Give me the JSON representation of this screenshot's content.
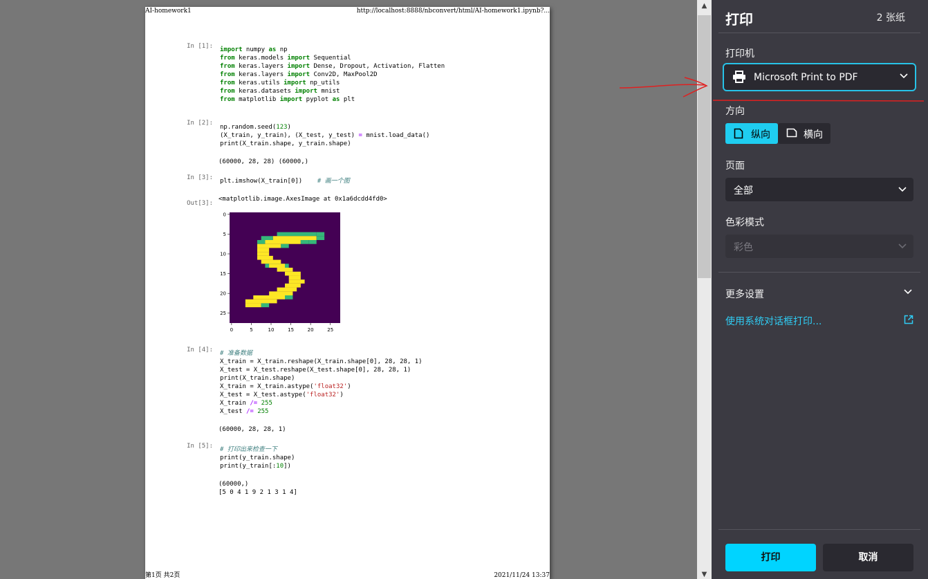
{
  "paper": {
    "header_left": "AI-homework1",
    "header_right": "http://localhost:8888/nbconvert/html/AI-homework1.ipynb?...",
    "footer_left": "第1页 共2页",
    "footer_right": "2021/11/24 13:37"
  },
  "notebook": {
    "prompts": [
      "In [1]:",
      "In [2]:",
      "In [3]:",
      "Out[3]:",
      "In [4]:",
      "In [5]:"
    ],
    "cell1": [
      {
        "kw": "import",
        "rest": " numpy ",
        "kw2": "as",
        "rest2": " np"
      },
      {
        "kw": "from",
        "rest": " keras.models ",
        "kw2": "import",
        "rest2": " Sequential"
      },
      {
        "kw": "from",
        "rest": " keras.layers ",
        "kw2": "import",
        "rest2": " Dense, Dropout, Activation, Flatten"
      },
      {
        "kw": "from",
        "rest": " keras.layers ",
        "kw2": "import",
        "rest2": " Conv2D, MaxPool2D"
      },
      {
        "kw": "from",
        "rest": " keras.utils ",
        "kw2": "import",
        "rest2": " np_utils"
      },
      {
        "kw": "from",
        "rest": " keras.datasets ",
        "kw2": "import",
        "rest2": " mnist"
      },
      {
        "kw": "from",
        "rest": " matplotlib ",
        "kw2": "import",
        "rest2": " pyplot ",
        "kw3": "as",
        "rest3": " plt"
      }
    ],
    "cell2": {
      "l1a": "np.random.seed(",
      "l1n": "123",
      "l1b": ")",
      "l2": "(X_train, y_train), (X_test, y_test) ",
      "l2op": "=",
      "l2b": " mnist.load_data()",
      "l3": "print(X_train.shape, y_train.shape)"
    },
    "out2": "(60000, 28, 28) (60000,)",
    "cell3_code": "plt.imshow(X_train[0])",
    "cell3_comment": "# 画一个图",
    "out3": "<matplotlib.image.AxesImage at 0x1a6dcdd4fd0>",
    "cell4": {
      "comment": "# 准备数据",
      "l1": "X_train = X_train.reshape(X_train.shape[0], 28, 28, 1)",
      "l2": "X_test = X_test.reshape(X_test.shape[0], 28, 28, 1)",
      "l3": "print(X_train.shape)",
      "l4a": "X_train = X_train.astype(",
      "l4s": "'float32'",
      "l4b": ")",
      "l5a": "X_test = X_test.astype(",
      "l5s": "'float32'",
      "l5b": ")",
      "l6a": "X_train ",
      "l6op": "/=",
      "l6n": " 255",
      "l7a": "X_test ",
      "l7op": "/=",
      "l7n": " 255"
    },
    "out4": "(60000, 28, 28, 1)",
    "cell5": {
      "comment": "# 打印出来检查一下",
      "l1": "print(y_train.shape)",
      "l2a": "print(y_train[:",
      "l2n": "10",
      "l2b": "])"
    },
    "out5_1": "(60000,)",
    "out5_2": "[5 0 4 1 9 2 1 3 1 4]"
  },
  "chart_data": {
    "type": "heatmap",
    "title": "",
    "xticks": [
      "0",
      "5",
      "10",
      "15",
      "20",
      "25"
    ],
    "yticks": [
      "0",
      "5",
      "10",
      "15",
      "20",
      "25"
    ],
    "xlim": [
      -0.5,
      27.5
    ],
    "ylim": [
      27.5,
      -0.5
    ],
    "colormap": "viridis",
    "background_color": "#440154",
    "digit_color": "#fde725",
    "mid_color": "#35b779",
    "pixels_label": "MNIST digit 5 (28x28)"
  },
  "panel": {
    "title": "打印",
    "sheets": "2 张纸",
    "printer_label": "打印机",
    "printer_value": "Microsoft Print to PDF",
    "orientation_label": "方向",
    "portrait": "纵向",
    "landscape": "横向",
    "pages_label": "页面",
    "pages_value": "全部",
    "color_label": "色彩模式",
    "color_value": "彩色",
    "more_settings": "更多设置",
    "system_dialog": "使用系统对话框打印...",
    "print": "打印",
    "cancel": "取消",
    "accent_color": "#00d4ff"
  }
}
